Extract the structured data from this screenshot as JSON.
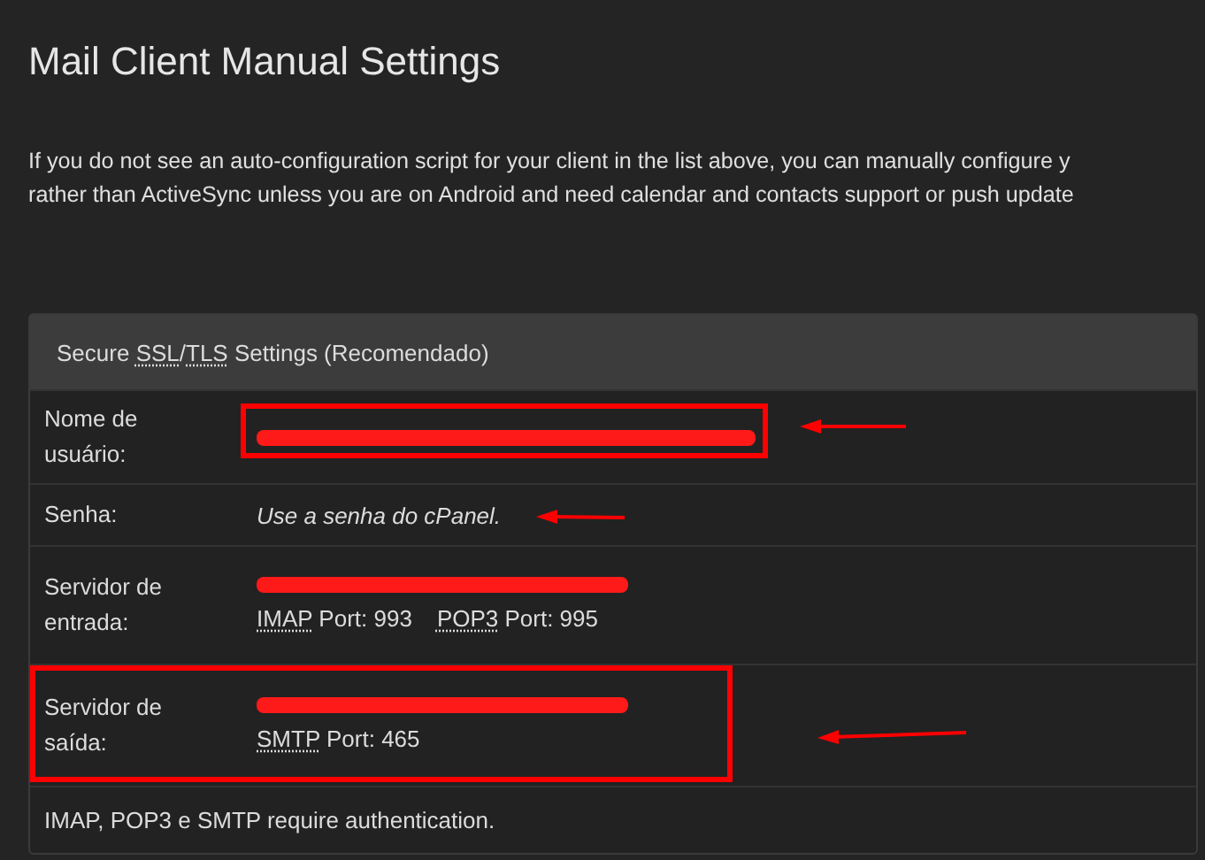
{
  "page_title": "Mail Client Manual Settings",
  "intro": [
    "If you do not see an auto-configuration script for your client in the list above, you can manually configure y",
    "rather than ActiveSync unless you are on Android and need calendar and contacts support or push update"
  ],
  "panel": {
    "heading": [
      {
        "text": "Secure ",
        "abbr": false
      },
      {
        "text": "SSL",
        "abbr": true
      },
      {
        "text": "/",
        "abbr": false
      },
      {
        "text": "TLS",
        "abbr": true
      },
      {
        "text": " Settings (Recomendado)",
        "abbr": false
      }
    ],
    "rows": [
      {
        "kind": "redacted",
        "label": "Nome de usuário:"
      },
      {
        "kind": "text",
        "label": "Senha:",
        "value": "Use a senha do cPanel."
      },
      {
        "kind": "server",
        "label": "Servidor de entrada:",
        "ports": [
          {
            "protocol": "IMAP",
            "text": " Port: 993"
          },
          {
            "protocol": "POP3",
            "text": " Port: 995"
          }
        ]
      },
      {
        "kind": "server",
        "label": "Servidor de saída:",
        "ports": [
          {
            "protocol": "SMTP",
            "text": " Port: 465"
          }
        ]
      }
    ],
    "footer": "IMAP, POP3 e SMTP require authentication."
  }
}
